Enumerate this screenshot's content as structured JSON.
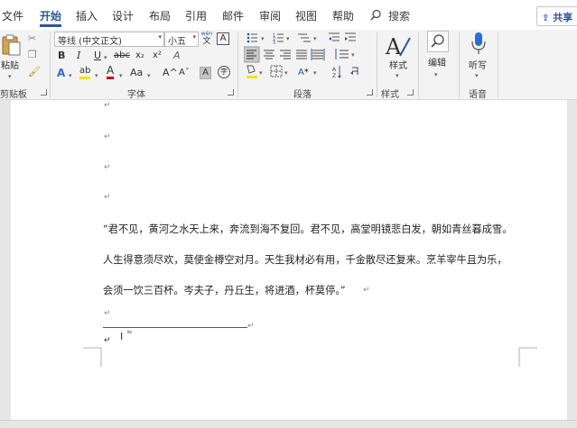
{
  "menu": {
    "file": "文件",
    "home": "开始",
    "insert": "插入",
    "design": "设计",
    "layout": "布局",
    "references": "引用",
    "mailings": "邮件",
    "review": "审阅",
    "view": "视图",
    "help": "帮助",
    "search": "搜索",
    "share": "共享"
  },
  "ribbon": {
    "clipboard": {
      "label": "剪贴板",
      "paste": "粘贴"
    },
    "font": {
      "label": "字体",
      "font_name": "等线 (中文正文)",
      "font_size": "小五",
      "wen": "wén",
      "wen_char": "文",
      "a_box": "A",
      "bold": "B",
      "italic": "I",
      "underline": "U",
      "strike": "abc",
      "subscript": "x₂",
      "superscript": "x²",
      "clear": "A",
      "text_effect": "A",
      "highlight": "ab",
      "font_color": "A",
      "change_case": "Aa",
      "grow": "A^",
      "shrink": "Aˇ",
      "char_shading": "A",
      "enclose": "字"
    },
    "paragraph": {
      "label": "段落"
    },
    "styles": {
      "label": "样式",
      "button": "样式"
    },
    "editing": {
      "button": "编辑"
    },
    "voice": {
      "label": "语音",
      "button": "听写"
    }
  },
  "document": {
    "lines": [
      "“君不见，黄河之水天上来，奔流到海不复回。君不见，高堂明镜悲白发，朝如青丝暮成雪。",
      "人生得意须尽欢，莫使金樽空对月。天生我材必有用，千金散尽还复来。烹羊宰牛且为乐，",
      "会须一饮三百杯。岑夫子，丹丘生，将进酒，杯莫停。”"
    ]
  }
}
